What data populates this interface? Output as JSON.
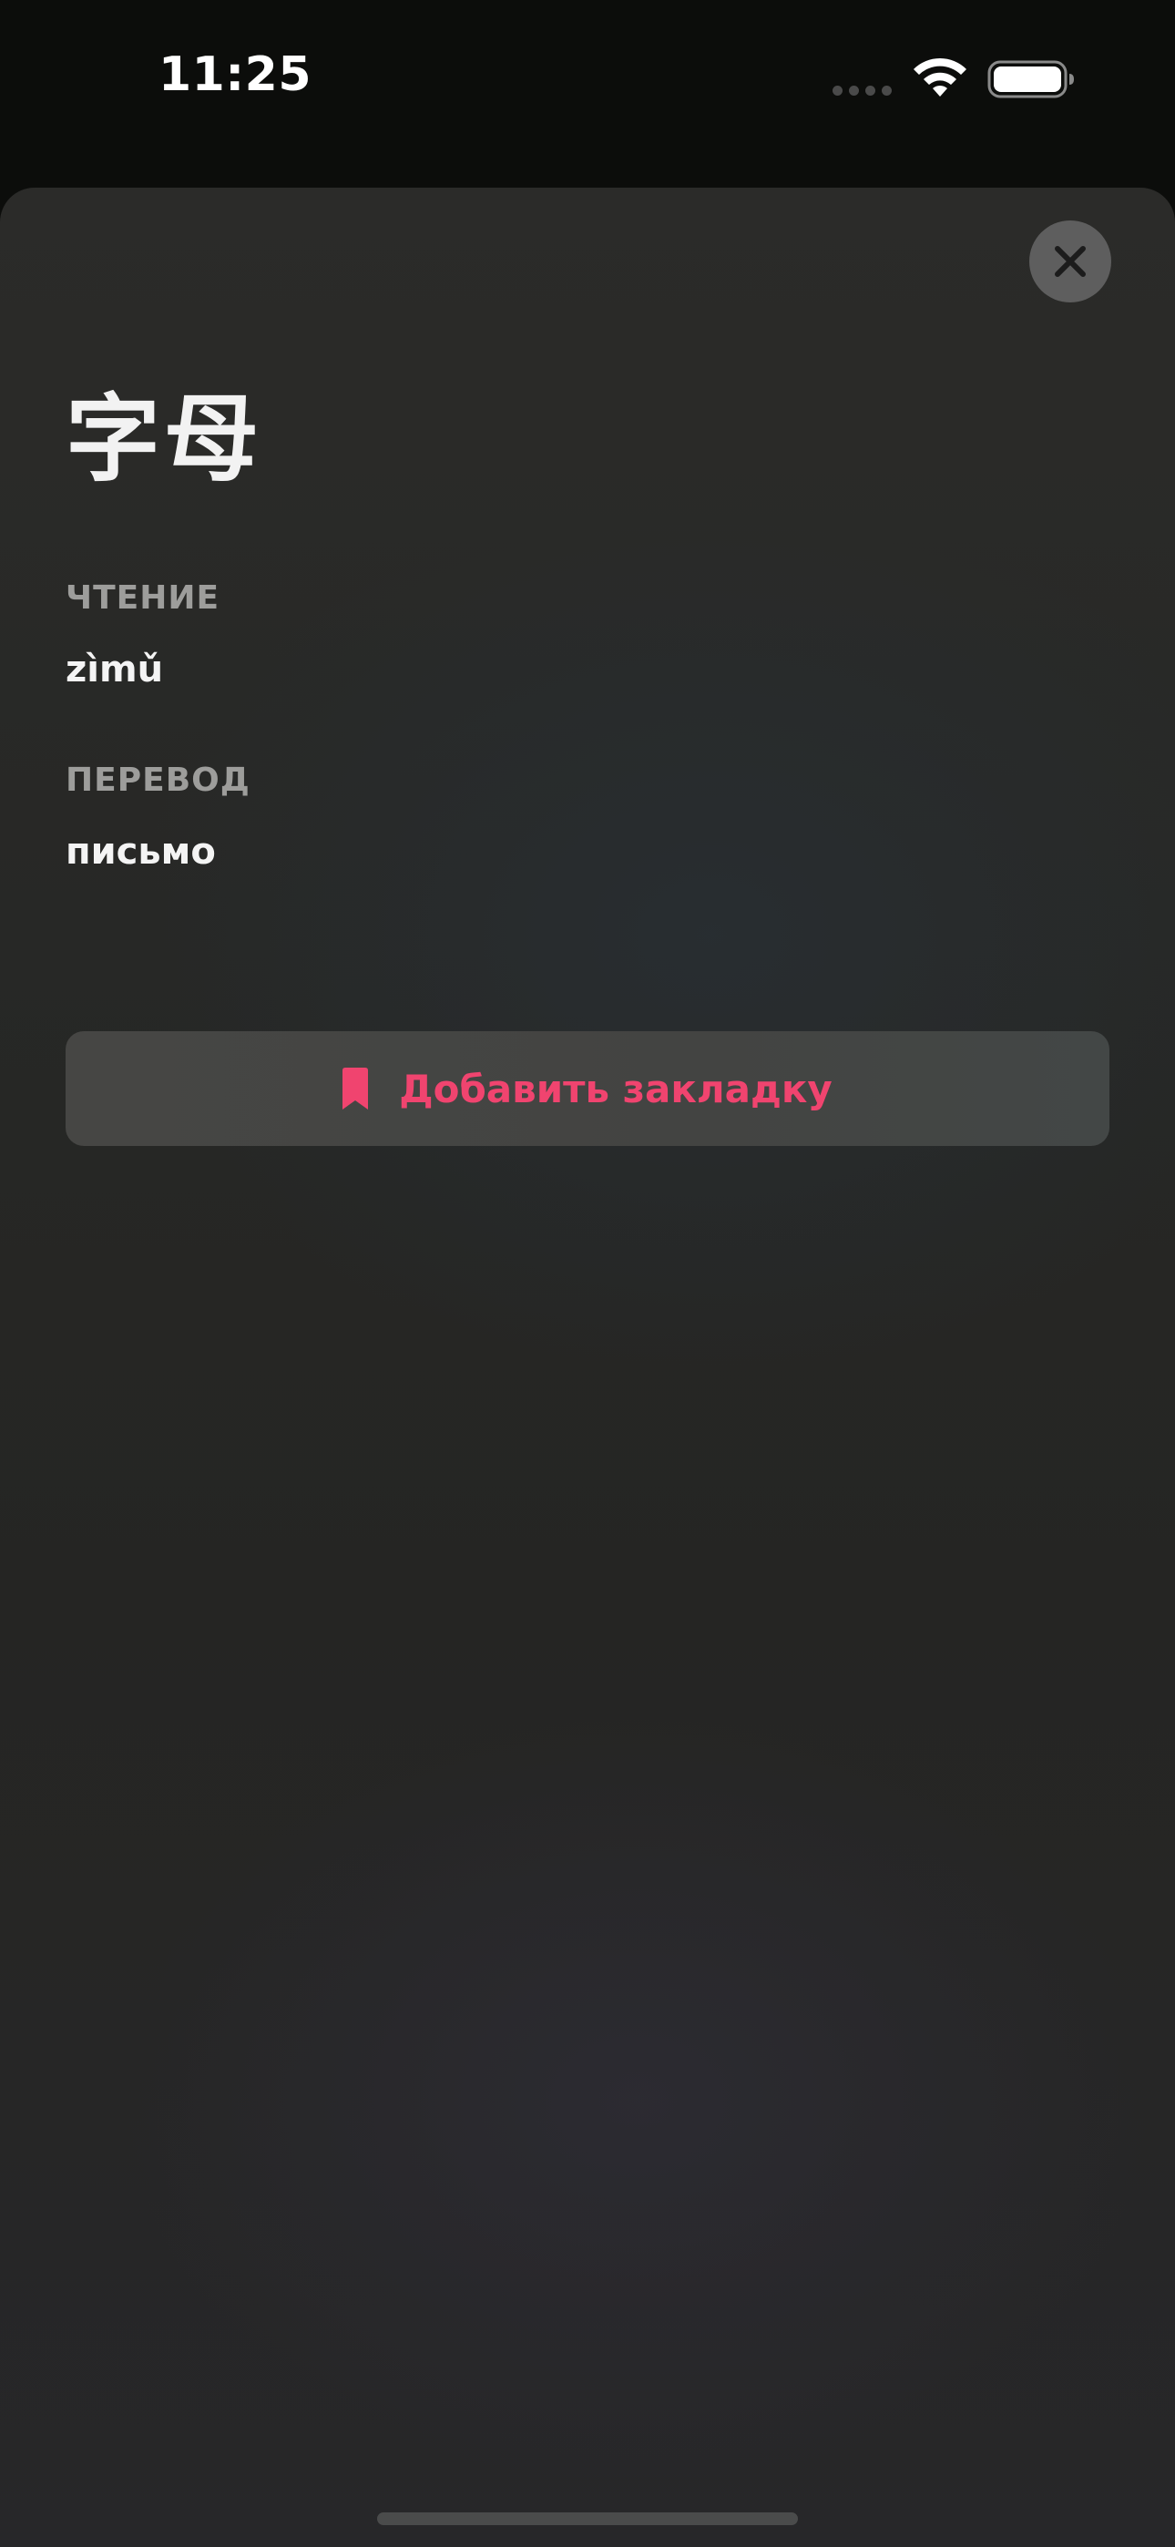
{
  "status_bar": {
    "time": "11:25",
    "wifi_icon": "wifi-icon",
    "battery_icon": "battery-icon",
    "signal_icon": "signal-dots-icon"
  },
  "sheet": {
    "close_icon": "close-icon",
    "word": "字母",
    "reading": {
      "label": "ЧТЕНИЕ",
      "value": "zìmǔ"
    },
    "translation": {
      "label": "ПЕРЕВОД",
      "value": "письмо"
    },
    "bookmark_button": {
      "icon": "bookmark-icon",
      "label": "Добавить закладку"
    }
  },
  "colors": {
    "accent": "#f0446f",
    "background": "#0c0d0b",
    "sheet": "#262725",
    "button": "#454644",
    "label_gray": "#9d9d9b"
  }
}
